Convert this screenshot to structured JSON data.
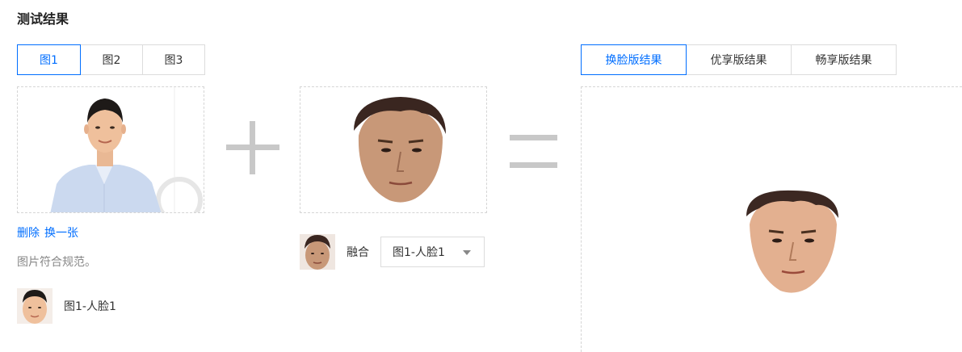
{
  "title": "测试结果",
  "image_tabs": [
    "图1",
    "图2",
    "图3"
  ],
  "image_tabs_active": 0,
  "result_tabs": [
    "换脸版结果",
    "优享版结果",
    "畅享版结果"
  ],
  "result_tabs_active": 0,
  "source": {
    "delete_label": "删除",
    "replace_label": "换一张",
    "hint": "图片符合规范。",
    "face_label": "图1-人脸1"
  },
  "template": {
    "merge_label": "融合",
    "select_value": "图1-人脸1"
  },
  "colors": {
    "accent": "#006eff",
    "border": "#dcdcdc",
    "operator": "#c8c8c8"
  }
}
